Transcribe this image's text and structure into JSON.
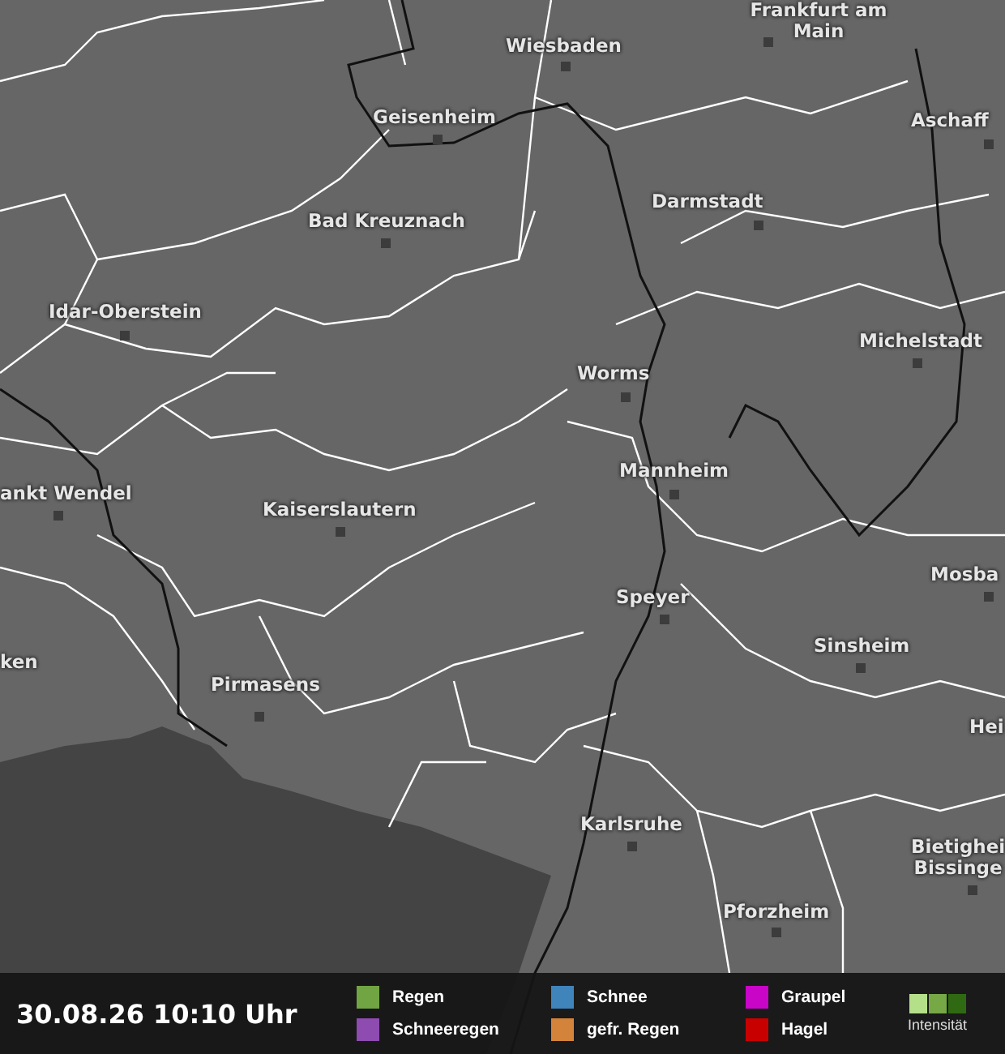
{
  "map": {
    "cities": [
      {
        "name": "Frankfurt am Main"
      },
      {
        "name": "Wiesbaden"
      },
      {
        "name": "Geisenheim"
      },
      {
        "name": "Aschaff"
      },
      {
        "name": "Bad Kreuznach"
      },
      {
        "name": "Darmstadt"
      },
      {
        "name": "Idar-Oberstein"
      },
      {
        "name": "Michelstadt"
      },
      {
        "name": "Worms"
      },
      {
        "name": "Mannheim"
      },
      {
        "name": "ankt Wendel"
      },
      {
        "name": "Kaiserslautern"
      },
      {
        "name": "Mosba"
      },
      {
        "name": "Speyer"
      },
      {
        "name": "Sinsheim"
      },
      {
        "name": "ken"
      },
      {
        "name": "Pirmasens"
      },
      {
        "name": "Hei"
      },
      {
        "name": "Karlsruhe"
      },
      {
        "name": "Bietighei Bissinge"
      },
      {
        "name": "Pforzheim"
      }
    ]
  },
  "footer": {
    "timestamp": "30.08.26 10:10 Uhr",
    "legend": [
      {
        "label": "Regen",
        "color": "#71a443"
      },
      {
        "label": "Schneeregen",
        "color": "#8e4bb0"
      },
      {
        "label": "Schnee",
        "color": "#3f84bb"
      },
      {
        "label": "gefr. Regen",
        "color": "#d4843a"
      },
      {
        "label": "Graupel",
        "color": "#c905c7"
      },
      {
        "label": "Hagel",
        "color": "#c80000"
      }
    ],
    "intensity": {
      "label": "Intensität"
    }
  }
}
